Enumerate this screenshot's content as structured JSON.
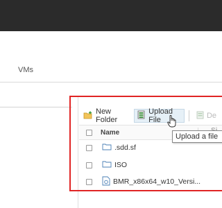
{
  "header": {
    "tabs": [
      {
        "label": "VMs"
      }
    ]
  },
  "toolbar": {
    "new_folder_label": "New Folder",
    "upload_file_label": "Upload File",
    "delete_label": "De"
  },
  "table": {
    "columns": [
      {
        "label": "Name"
      },
      {
        "label": "Si"
      }
    ],
    "rows": [
      {
        "name": ".sdd.sf",
        "icon": "folder-icon"
      },
      {
        "name": "ISO",
        "icon": "folder-icon"
      },
      {
        "name": "BMR_x86x64_w10_Versi...",
        "icon": "file-icon"
      }
    ]
  },
  "tooltip": {
    "text": "Upload a file"
  },
  "colors": {
    "highlight_box": "#e02424",
    "topbar": "#2b2b2b",
    "active_button_bg": "#e6f0f7"
  }
}
